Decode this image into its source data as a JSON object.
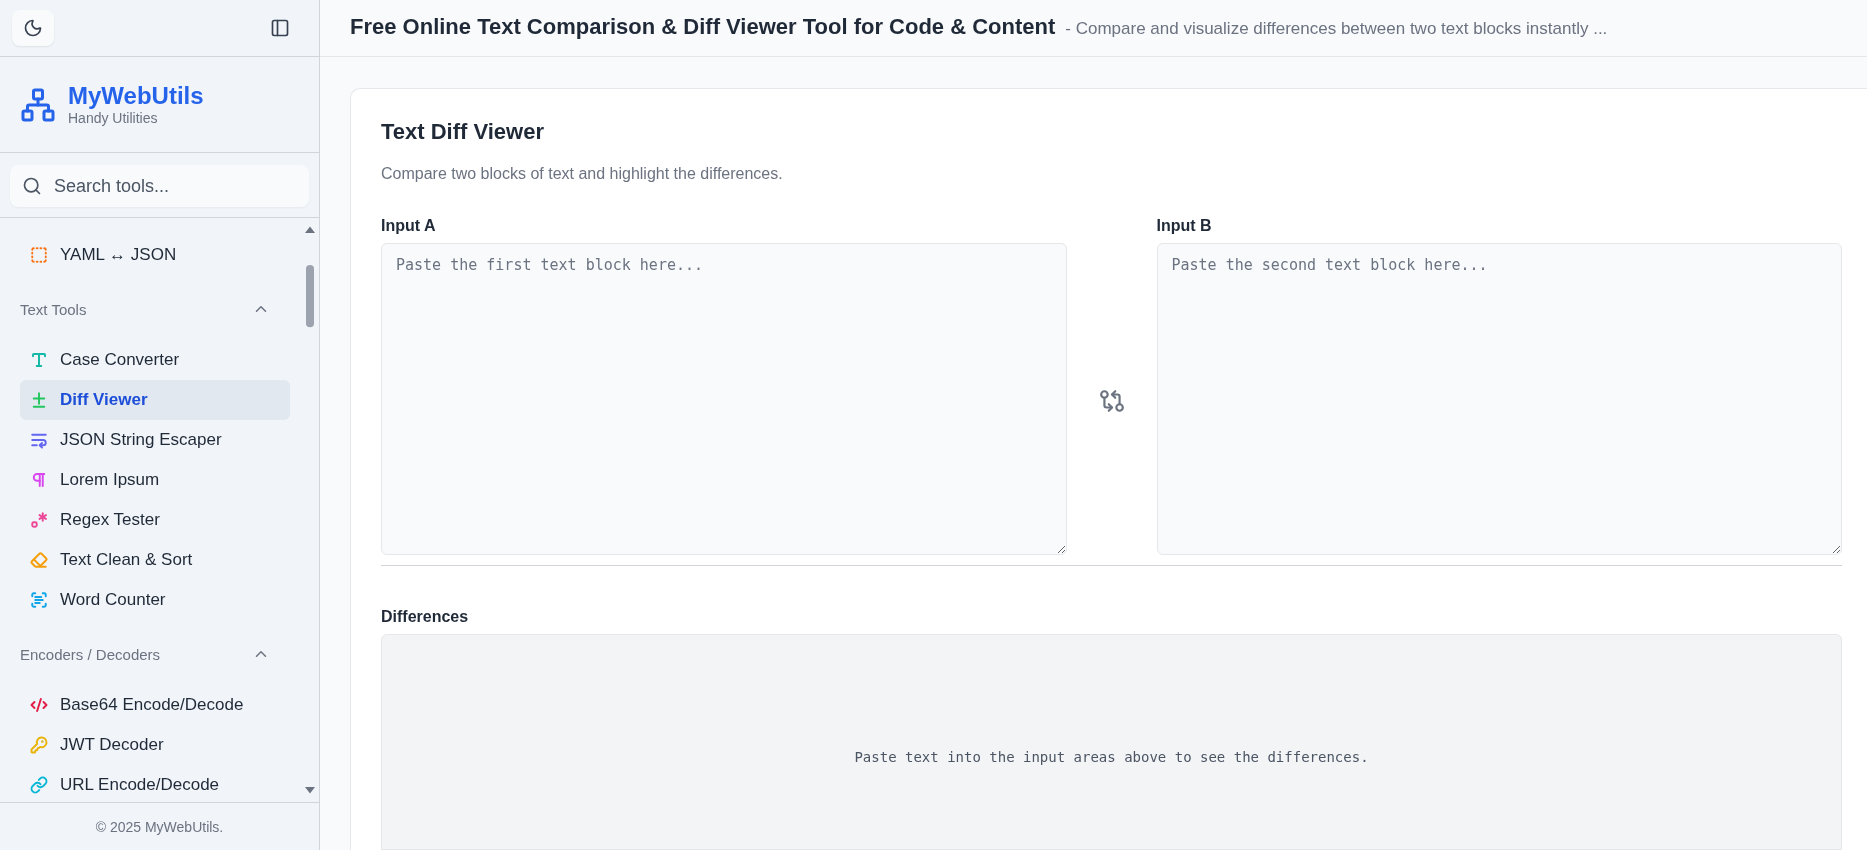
{
  "sidebar": {
    "brand": {
      "name": "MyWebUtils",
      "tagline": "Handy Utilities"
    },
    "search": {
      "placeholder": "Search tools..."
    },
    "groups": [
      {
        "items": [
          {
            "label": "YAML ↔ JSON",
            "selected": false,
            "color": "#f97316"
          }
        ]
      },
      {
        "title": "Text Tools",
        "expanded": true,
        "items": [
          {
            "label": "Case Converter",
            "selected": false,
            "color": "#14b8a6"
          },
          {
            "label": "Diff Viewer",
            "selected": true,
            "color": "#22c55e"
          },
          {
            "label": "JSON String Escaper",
            "selected": false,
            "color": "#6366f1"
          },
          {
            "label": "Lorem Ipsum",
            "selected": false,
            "color": "#d946ef"
          },
          {
            "label": "Regex Tester",
            "selected": false,
            "color": "#ec4899"
          },
          {
            "label": "Text Clean & Sort",
            "selected": false,
            "color": "#f59e0b"
          },
          {
            "label": "Word Counter",
            "selected": false,
            "color": "#0ea5e9"
          }
        ]
      },
      {
        "title": "Encoders / Decoders",
        "expanded": true,
        "items": [
          {
            "label": "Base64 Encode/Decode",
            "selected": false,
            "color": "#e11d48"
          },
          {
            "label": "JWT Decoder",
            "selected": false,
            "color": "#eab308"
          },
          {
            "label": "URL Encode/Decode",
            "selected": false,
            "color": "#06b6d4"
          }
        ]
      }
    ],
    "footer": "© 2025 MyWebUtils."
  },
  "header": {
    "title": "Free Online Text Comparison & Diff Viewer Tool for Code & Content",
    "subtitle": "- Compare and visualize differences between two text blocks instantly ..."
  },
  "card": {
    "title": "Text Diff Viewer",
    "description": "Compare two blocks of text and highlight the differences.",
    "inputs": [
      {
        "label": "Input A",
        "placeholder": "Paste the first text block here..."
      },
      {
        "label": "Input B",
        "placeholder": "Paste the second text block here..."
      }
    ],
    "differences": {
      "label": "Differences",
      "message": "Paste text into the input areas above to see the differences."
    }
  }
}
